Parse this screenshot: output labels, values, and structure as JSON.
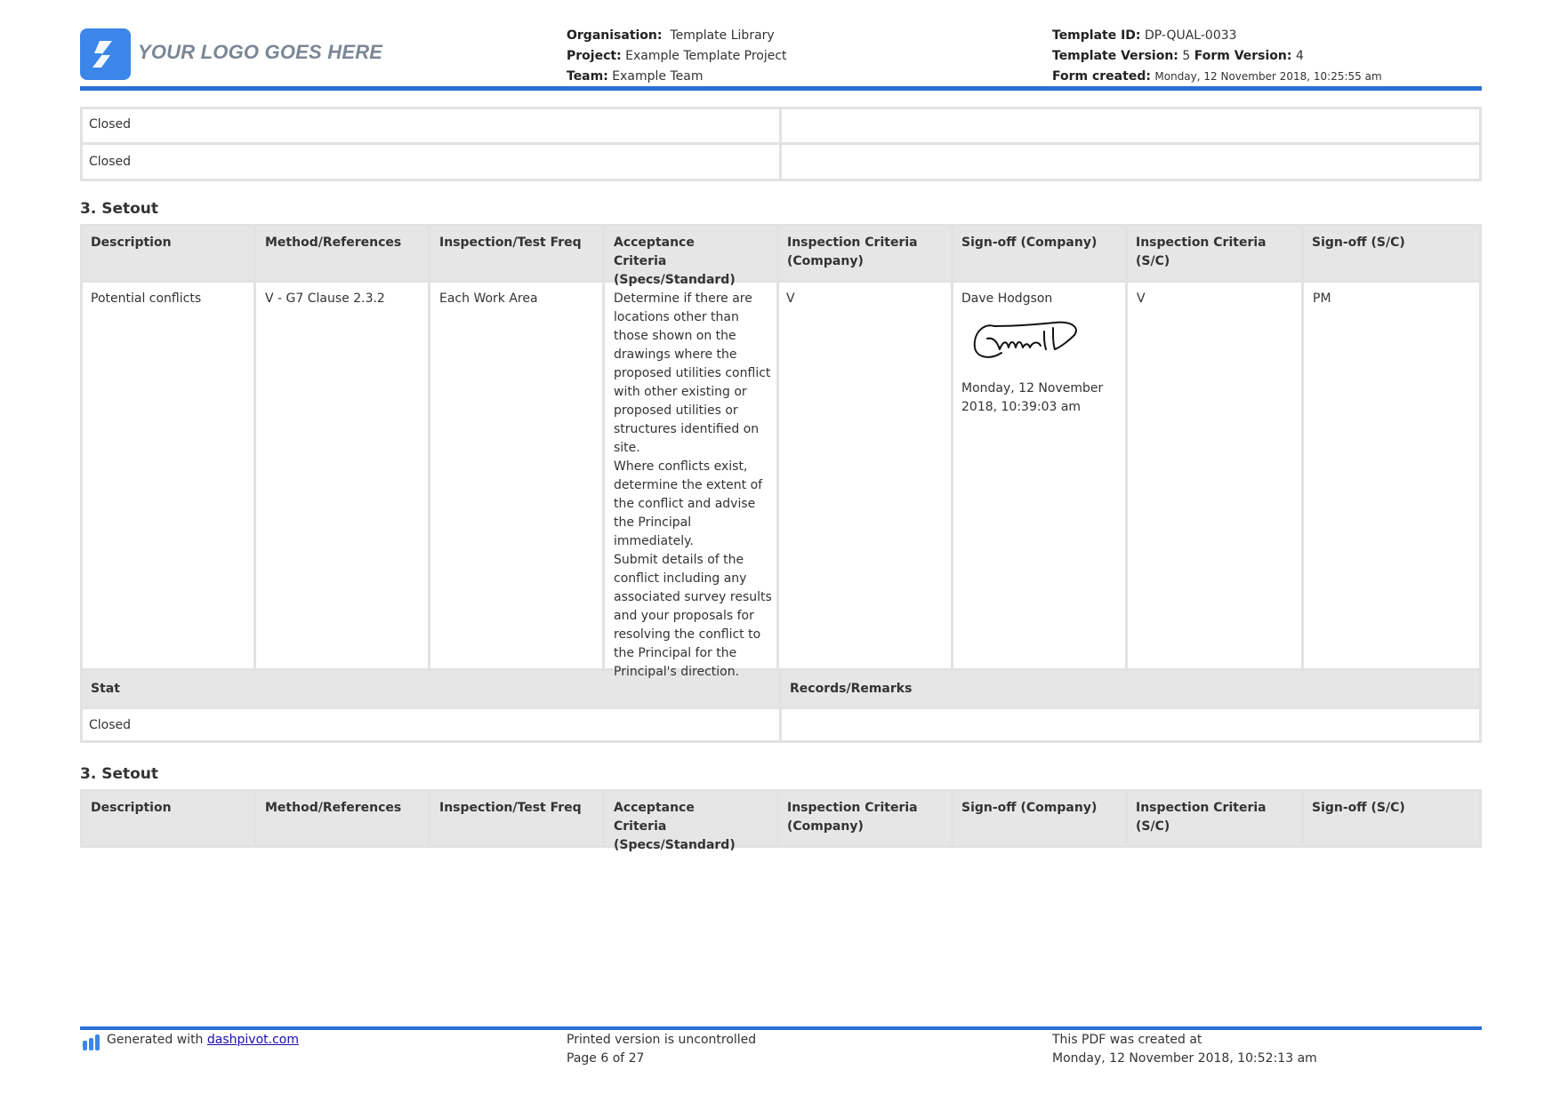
{
  "header": {
    "logo_text": "YOUR LOGO GOES HERE",
    "organisation_label": "Organisation:",
    "organisation_value": "Template Library",
    "project_label": "Project:",
    "project_value": "Example Template Project",
    "team_label": "Team:",
    "team_value": "Example Team",
    "template_id_label": "Template ID:",
    "template_id_value": "DP-QUAL-0033",
    "template_version_label": "Template Version:",
    "template_version_value": "5",
    "form_version_label": "Form Version:",
    "form_version_value": "4",
    "form_created_label": "Form created:",
    "form_created_value": "Monday, 12 November 2018, 10:25:55 am"
  },
  "top_table": {
    "rows": [
      {
        "status": "Closed",
        "remarks": ""
      },
      {
        "status": "Closed",
        "remarks": ""
      }
    ]
  },
  "section1": {
    "title": "3. Setout",
    "columns": [
      "Description",
      "Method/References",
      "Inspection/Test Freq",
      "Acceptance Criteria (Specs/Standard)",
      "Inspection Criteria (Company)",
      "Sign-off (Company)",
      "Inspection Criteria (S/C)",
      "Sign-off (S/C)"
    ],
    "row": {
      "description": "Potential conflicts",
      "method": "V - G7 Clause 2.3.2",
      "freq": "Each Work Area",
      "acceptance": "Determine if there are locations other than those shown on the drawings where the proposed utilities conflict with other existing or proposed utilities or structures identified on site.\nWhere conflicts exist, determine the extent of the conflict and advise the Principal immediately.\nSubmit details of the conflict including any associated survey results and your proposals for resolving the conflict to the Principal for the Principal's direction.",
      "insp_company": "V",
      "signoff_company_name": "Dave Hodgson",
      "signoff_company_date": "Monday, 12 November 2018, 10:39:03 am",
      "insp_sc": "V",
      "signoff_sc": "PM"
    },
    "stat_label": "Stat",
    "remarks_label": "Records/Remarks",
    "stat_value": "Closed",
    "remarks_value": ""
  },
  "section2": {
    "title": "3. Setout",
    "columns": [
      "Description",
      "Method/References",
      "Inspection/Test Freq",
      "Acceptance Criteria (Specs/Standard)",
      "Inspection Criteria (Company)",
      "Sign-off (Company)",
      "Inspection Criteria (S/C)",
      "Sign-off (S/C)"
    ]
  },
  "footer": {
    "generated_prefix": "Generated with",
    "generated_link": "dashpivot.com",
    "uncontrolled": "Printed version is uncontrolled",
    "page": "Page 6 of 27",
    "created_label": "This PDF was created at",
    "created_value": "Monday, 12 November 2018, 10:52:13 am"
  },
  "colors": {
    "accent": "#2a6fd6",
    "logo": "#3b86e8",
    "header_cell": "#e6e6e6",
    "border": "#e2e2e2"
  }
}
